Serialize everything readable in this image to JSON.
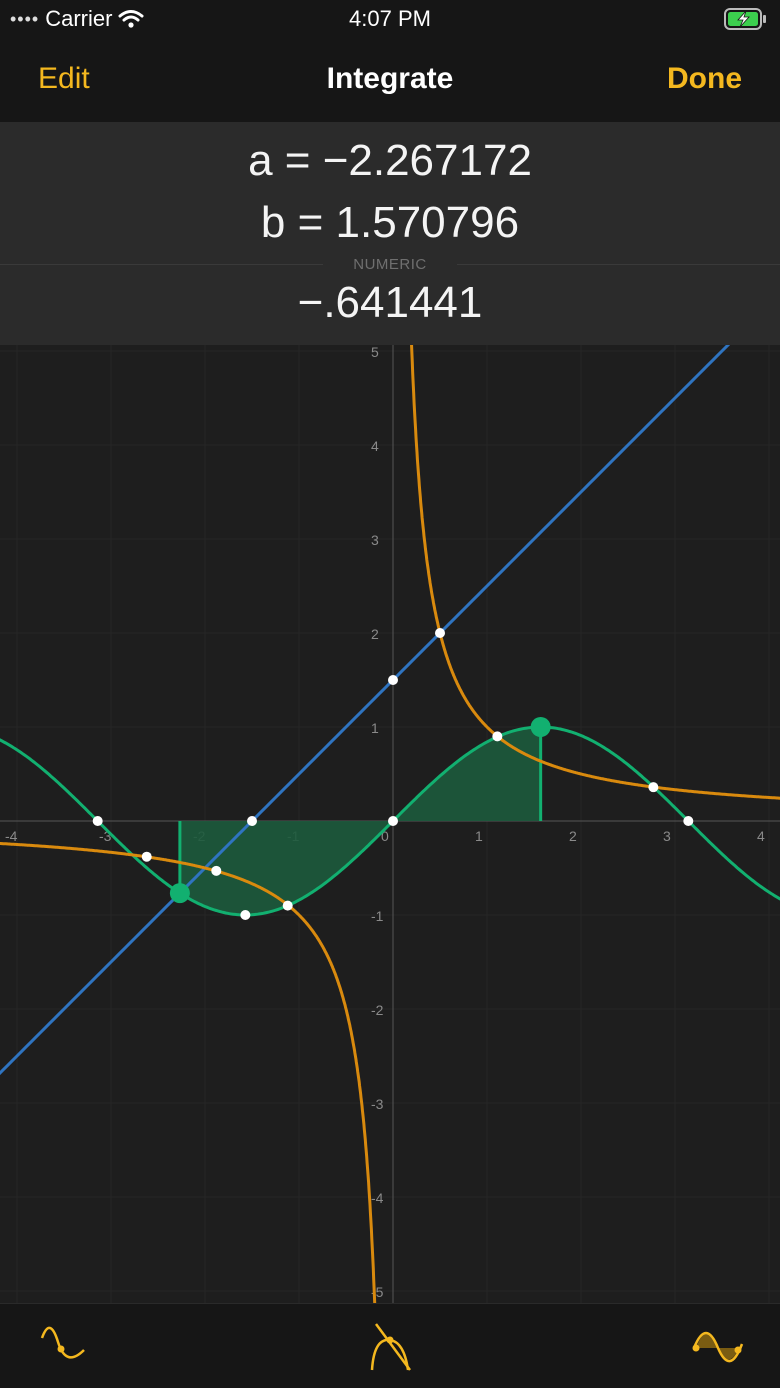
{
  "status_bar": {
    "carrier": "Carrier",
    "time": "4:07 PM",
    "icons": [
      "signal-dots-icon",
      "wifi-icon",
      "battery-charging-icon"
    ]
  },
  "nav": {
    "edit_label": "Edit",
    "title": "Integrate",
    "done_label": "Done"
  },
  "params": {
    "a": "a = −2.267172",
    "b": "b = 1.570796",
    "mode_label": "NUMERIC",
    "result": "−.641441"
  },
  "graph": {
    "x_ticks": [
      "-4",
      "-3",
      "-2",
      "-1",
      "0",
      "1",
      "2",
      "3",
      "4"
    ],
    "y_ticks": [
      "5",
      "4",
      "3",
      "2",
      "1",
      "-1",
      "-2",
      "-3",
      "-4",
      "-5"
    ],
    "colors": {
      "line": "#2f74c0",
      "sine": "#12b070",
      "hyperbola": "#d98a0e",
      "fill": "#1c5a3c",
      "background": "#1e1e1e"
    }
  },
  "toolbar": {
    "tools": [
      "sine-curve-icon",
      "tangent-curve-icon",
      "integral-area-icon"
    ]
  }
}
